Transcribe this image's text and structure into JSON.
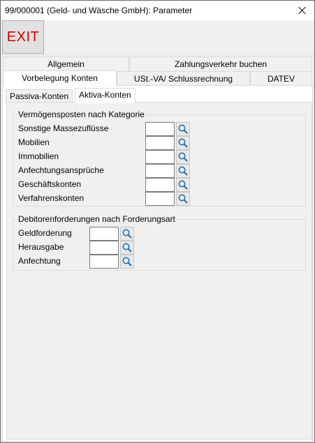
{
  "window": {
    "title": "99/000001 (Geld- und Wäsche GmbH): Parameter"
  },
  "toolbar": {
    "exit_label": "EXIT"
  },
  "tabs": {
    "row1": [
      "Allgemein",
      "Zahlungsverkehr buchen"
    ],
    "row2": [
      "Vorbelegung Konten",
      "USt.-VA/ Schlussrechnung",
      "DATEV"
    ],
    "active": "Vorbelegung Konten"
  },
  "subtabs": {
    "items": [
      "Passiva-Konten",
      "Aktiva-Konten"
    ],
    "active": "Aktiva-Konten"
  },
  "group1": {
    "title": "Vermögensposten nach Kategorie",
    "rows": [
      {
        "label": "Sonstige Massezuflüsse",
        "value": ""
      },
      {
        "label": "Mobilien",
        "value": ""
      },
      {
        "label": "Immobilien",
        "value": ""
      },
      {
        "label": "Anfechtungsansprüche",
        "value": ""
      },
      {
        "label": "Geschäftskonten",
        "value": ""
      },
      {
        "label": "Verfahrenskonten",
        "value": ""
      }
    ]
  },
  "group2": {
    "title": "Debitorenforderungen nach Forderungsart",
    "rows": [
      {
        "label": "Geldforderung",
        "value": ""
      },
      {
        "label": "Herausgabe",
        "value": ""
      },
      {
        "label": "Anfechtung",
        "value": ""
      }
    ]
  },
  "icons": {
    "close": "close-icon",
    "search": "magnifier-icon"
  },
  "colors": {
    "exit_text": "#d40000",
    "window_bg": "#f0f0f0"
  }
}
